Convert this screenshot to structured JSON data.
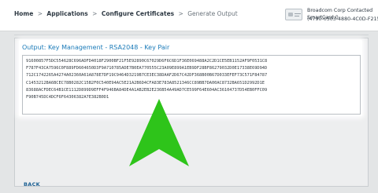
{
  "breadcrumb": {
    "items": [
      "Home",
      "Applications",
      "Configure Certificates"
    ],
    "current": "Generate Output",
    "separator": ">"
  },
  "device": {
    "icon": "smartcard-icon",
    "name": "Broadcom Corp Contacted SmartCard 0",
    "id": "(4790-0503-4880-4C0D-F215)"
  },
  "output": {
    "title": "Output: Key Management - RSA2048 - Key Pair",
    "lines": [
      "91600857F5DC554628C696ADFD4018F2900BF21F5E92890C67029D6F6C6D1F36E069488A2C2D1CE5EB1152AF9F0531C8",
      "F787F43CA7596C0F889FD604650D3F9A710785ADE7B0EA770555C23A09E899A1EB9DF28BF86279032D0E17338E69D94D",
      "712C1742265A4274A02360A61A878E7DF19C9464D3219B7CE3EC38DAAF2D67C42DF368B00B67D033EFEF73C571F84787",
      "C1453212BA6BCEC78B0282C15B2F0C540E94AC5E21A2B6D4CFA83E783A8521346CC89BB7DA00AC8732BA651D2992D1E",
      "83688ACFDEC64B1CE1112D899D9EFF4F946BA84DE4A1AB2EB2E236B54A49AD7CE599F64E604AC36104737D54EB0FFC09",
      "F90B745DC4DCF6F64306382A7E382B0D1"
    ]
  },
  "overlay": {
    "arrow_color": "#2ec41a",
    "arrow_icon": "up-arrow-icon"
  },
  "nav": {
    "back_label": "BACK"
  },
  "colors": {
    "accent": "#1a7ab8",
    "link": "#1a5f92"
  }
}
